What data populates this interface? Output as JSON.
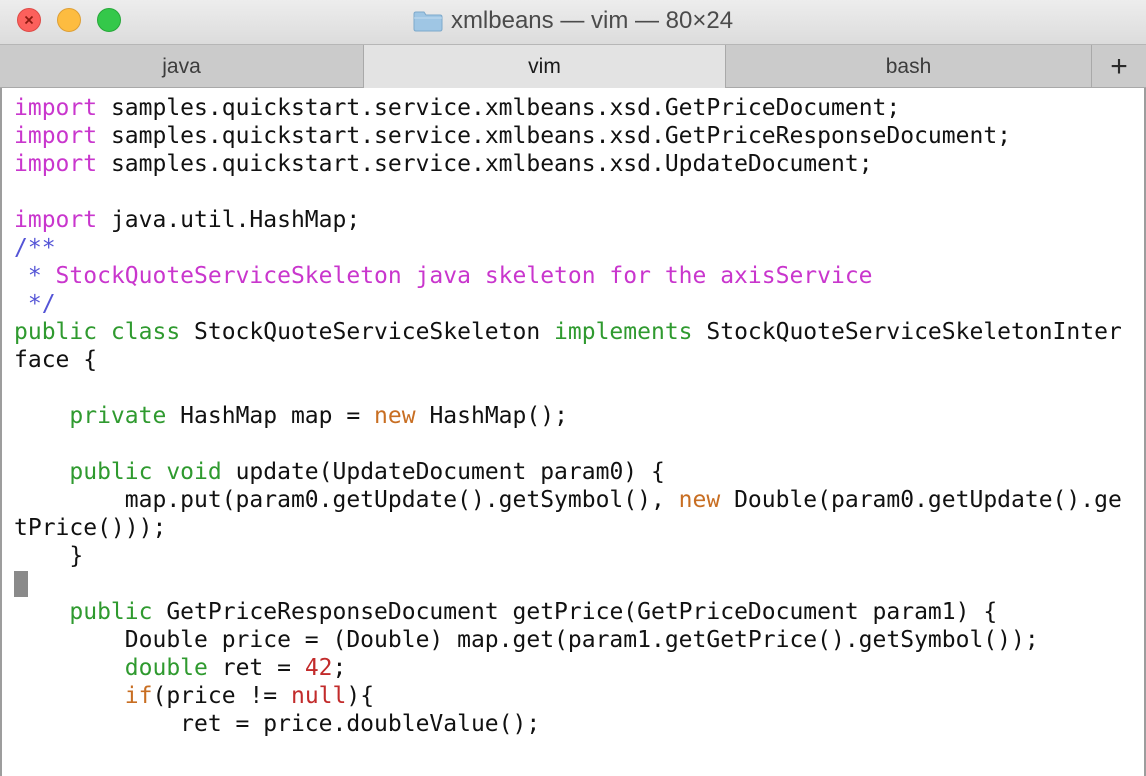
{
  "window": {
    "title": "xmlbeans — vim — 80×24",
    "folder_icon": "folder-icon"
  },
  "tabs": [
    {
      "label": "java"
    },
    {
      "label": "vim"
    },
    {
      "label": "bash"
    }
  ],
  "add_tab": {
    "label": "+"
  },
  "code": {
    "lines": [
      [
        {
          "t": "import",
          "c": "c-import"
        },
        {
          "t": " samples.quickstart.service.xmlbeans.xsd.GetPriceDocument;",
          "c": "c-plain"
        }
      ],
      [
        {
          "t": "import",
          "c": "c-import"
        },
        {
          "t": " samples.quickstart.service.xmlbeans.xsd.GetPriceResponseDocument;",
          "c": "c-plain"
        }
      ],
      [
        {
          "t": "import",
          "c": "c-import"
        },
        {
          "t": " samples.quickstart.service.xmlbeans.xsd.UpdateDocument;",
          "c": "c-plain"
        }
      ],
      [],
      [
        {
          "t": "import",
          "c": "c-import"
        },
        {
          "t": " java.util.HashMap;",
          "c": "c-plain"
        }
      ],
      [
        {
          "t": "/**",
          "c": "c-comment-mark"
        }
      ],
      [
        {
          "t": " *",
          "c": "c-comment-mark"
        },
        {
          "t": " StockQuoteServiceSkeleton java skeleton for the axisService",
          "c": "c-comment"
        }
      ],
      [
        {
          "t": " */",
          "c": "c-comment-mark"
        }
      ],
      [
        {
          "t": "public class",
          "c": "c-kw"
        },
        {
          "t": " StockQuoteServiceSkeleton ",
          "c": "c-plain"
        },
        {
          "t": "implements",
          "c": "c-kw"
        },
        {
          "t": " StockQuoteServiceSkeletonInter",
          "c": "c-plain"
        }
      ],
      [
        {
          "t": "face {",
          "c": "c-plain"
        }
      ],
      [],
      [
        {
          "t": "    ",
          "c": "c-plain"
        },
        {
          "t": "private",
          "c": "c-kw"
        },
        {
          "t": " HashMap map = ",
          "c": "c-plain"
        },
        {
          "t": "new",
          "c": "c-new"
        },
        {
          "t": " HashMap();",
          "c": "c-plain"
        }
      ],
      [],
      [
        {
          "t": "    ",
          "c": "c-plain"
        },
        {
          "t": "public void",
          "c": "c-kw"
        },
        {
          "t": " update(UpdateDocument param0) {",
          "c": "c-plain"
        }
      ],
      [
        {
          "t": "        map.put(param0.getUpdate().getSymbol(), ",
          "c": "c-plain"
        },
        {
          "t": "new",
          "c": "c-new"
        },
        {
          "t": " Double(param0.getUpdate().ge",
          "c": "c-plain"
        }
      ],
      [
        {
          "t": "tPrice()));",
          "c": "c-plain"
        }
      ],
      [
        {
          "t": "    }",
          "c": "c-plain"
        }
      ],
      [
        {
          "cursor": true
        }
      ],
      [
        {
          "t": "    ",
          "c": "c-plain"
        },
        {
          "t": "public",
          "c": "c-kw"
        },
        {
          "t": " GetPriceResponseDocument getPrice(GetPriceDocument param1) {",
          "c": "c-plain"
        }
      ],
      [
        {
          "t": "        Double price = (Double) map.get(param1.getGetPrice().getSymbol());",
          "c": "c-plain"
        }
      ],
      [
        {
          "t": "        ",
          "c": "c-plain"
        },
        {
          "t": "double",
          "c": "c-kw"
        },
        {
          "t": " ret = ",
          "c": "c-plain"
        },
        {
          "t": "42",
          "c": "c-num"
        },
        {
          "t": ";",
          "c": "c-plain"
        }
      ],
      [
        {
          "t": "        ",
          "c": "c-plain"
        },
        {
          "t": "if",
          "c": "c-new"
        },
        {
          "t": "(price != ",
          "c": "c-plain"
        },
        {
          "t": "null",
          "c": "c-null"
        },
        {
          "t": "){",
          "c": "c-plain"
        }
      ],
      [
        {
          "t": "            ret = price.doubleValue();",
          "c": "c-plain"
        }
      ]
    ]
  }
}
